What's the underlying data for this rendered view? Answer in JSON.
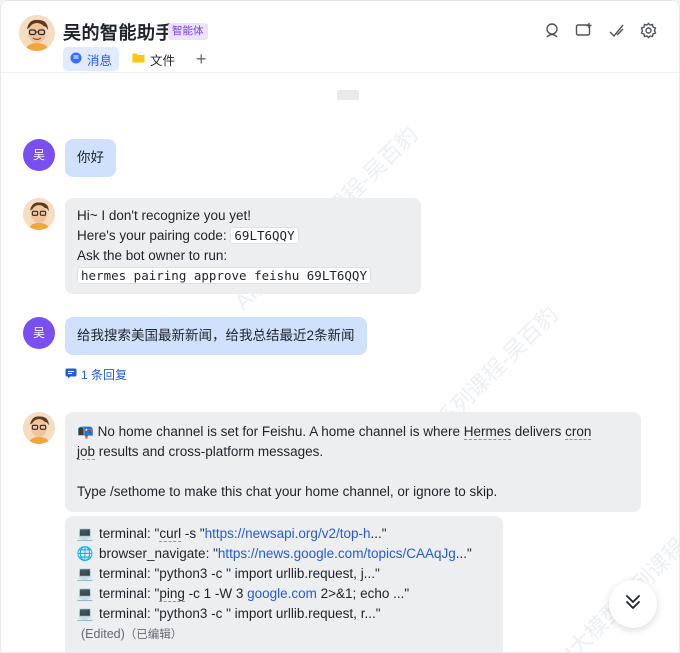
{
  "header": {
    "title": "吴的智能助手",
    "badge": "智能体",
    "tabs": [
      {
        "label": "消息",
        "icon": "chat-bubble-icon",
        "active": true
      },
      {
        "label": "文件",
        "icon": "folder-icon",
        "active": false
      }
    ],
    "add_tab": "+",
    "actions": [
      "search-person-icon",
      "add-chat-icon",
      "check-edit-icon",
      "gear-icon"
    ]
  },
  "messages": {
    "m1": {
      "avatar_text": "吴",
      "text": "你好"
    },
    "m2": {
      "line1": "Hi~ I don't recognize you yet!",
      "line2_prefix": "Here's your pairing code: ",
      "code": "69LT6QQY",
      "line3": "Ask the bot owner to run:",
      "command": "hermes pairing approve feishu 69LT6QQY"
    },
    "m3": {
      "avatar_text": "吴",
      "text": "给我搜索美国最新新闻，给我总结最近2条新闻",
      "reply_count": "1 条回复"
    },
    "m4": {
      "emoji": "📭",
      "p1_a": "No home channel is set for Feishu. A home channel is where ",
      "p1_b": "Hermes",
      "p1_c": " delivers ",
      "p1_d": "cron",
      "p1_e": "job",
      "p1_f": " results and cross-platform messages.",
      "p2": "Type /sethome to make this chat your home channel, or ignore to skip."
    },
    "m5": {
      "tools": [
        {
          "icon": "💻",
          "pre": "terminal: \"",
          "kw": "curl",
          "mid": " -s \"",
          "link": "https://newsapi.org/v2/top-h",
          "post": "...\""
        },
        {
          "icon": "🌐",
          "pre": "browser_navigate: \"",
          "kw": "",
          "mid": "",
          "link": "https://news.google.com/topics/CAAqJg",
          "post": "...\""
        },
        {
          "icon": "💻",
          "pre": "terminal: \"python3 -c \" import urllib.request, j...\"",
          "kw": "",
          "mid": "",
          "link": "",
          "post": ""
        },
        {
          "icon": "💻",
          "pre": "terminal: \"",
          "kw": "ping",
          "mid": " -c 1 -W 3 ",
          "link": "google.com",
          "post": " 2>&1; echo ...\""
        },
        {
          "icon": "💻",
          "pre": "terminal: \"python3 -c \" import urllib.request, r...\"",
          "kw": "",
          "mid": "",
          "link": "",
          "post": ""
        }
      ],
      "edited": "(Edited)",
      "edited_cn": "（已编辑）"
    }
  },
  "watermark": "AI大模型系列课程-吴百豹"
}
